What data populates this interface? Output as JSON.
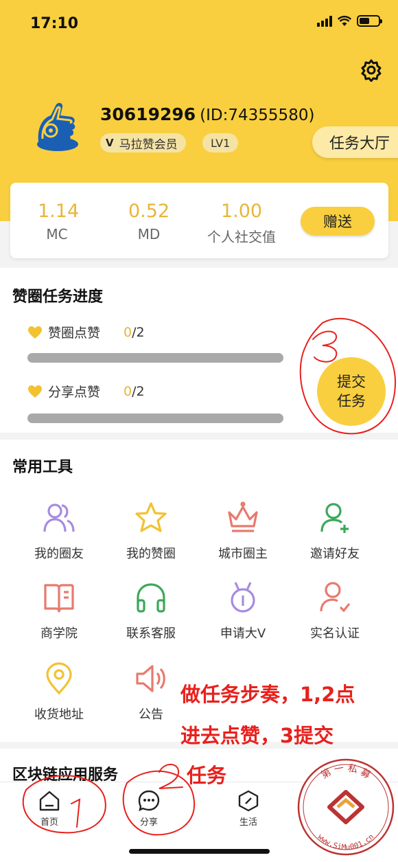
{
  "status": {
    "time": "17:10"
  },
  "profile": {
    "username": "30619296",
    "id_text": "(ID:74355580)",
    "member_badge_v": "V",
    "member_badge": "马拉赞会员",
    "level": "LV1",
    "task_hall": "任务大厅"
  },
  "stats": {
    "mc_value": "1.14",
    "mc_label": "MC",
    "md_value": "0.52",
    "md_label": "MD",
    "social_value": "1.00",
    "social_label": "个人社交值",
    "gift_label": "赠送"
  },
  "task_progress": {
    "title": "赞圈任务进度",
    "tasks": [
      {
        "label": "赞圈点赞",
        "done": "0",
        "total": "/2",
        "progress": 0
      },
      {
        "label": "分享点赞",
        "done": "0",
        "total": "/2",
        "progress": 0
      }
    ],
    "submit_line1": "提交",
    "submit_line2": "任务"
  },
  "tools": {
    "title": "常用工具",
    "items": [
      {
        "label": "我的圈友",
        "icon": "friends-icon",
        "color": "#a78be0"
      },
      {
        "label": "我的赞圈",
        "icon": "star-icon",
        "color": "#f2c231"
      },
      {
        "label": "城市圈主",
        "icon": "crown-icon",
        "color": "#e77a6e"
      },
      {
        "label": "邀请好友",
        "icon": "add-user-icon",
        "color": "#3aa85b"
      },
      {
        "label": "商学院",
        "icon": "book-icon",
        "color": "#e77a6e"
      },
      {
        "label": "联系客服",
        "icon": "headphones-icon",
        "color": "#3aa85b"
      },
      {
        "label": "申请大V",
        "icon": "medal-icon",
        "color": "#a78be0"
      },
      {
        "label": "实名认证",
        "icon": "verified-user-icon",
        "color": "#e77a6e"
      },
      {
        "label": "收货地址",
        "icon": "location-icon",
        "color": "#f2c231"
      },
      {
        "label": "公告",
        "icon": "speaker-icon",
        "color": "#e77a6e"
      }
    ]
  },
  "blockchain": {
    "title": "区块链应用服务"
  },
  "annotations": {
    "line1": "做任务步奏，1,2点",
    "line2": "进去点赞，3提交",
    "task_word": "任务"
  },
  "tabbar": {
    "items": [
      {
        "label": "首页",
        "icon": "home-icon"
      },
      {
        "label": "分享",
        "icon": "chat-icon"
      },
      {
        "label": "生活",
        "icon": "life-icon"
      }
    ]
  },
  "watermark": {
    "text_top": "第 一 私 募",
    "text_bottom": "www.SiMu001.cn"
  },
  "colors": {
    "brand_yellow": "#f9cf3f",
    "value_gold": "#e8b53a",
    "annotation_red": "#e8201c"
  }
}
